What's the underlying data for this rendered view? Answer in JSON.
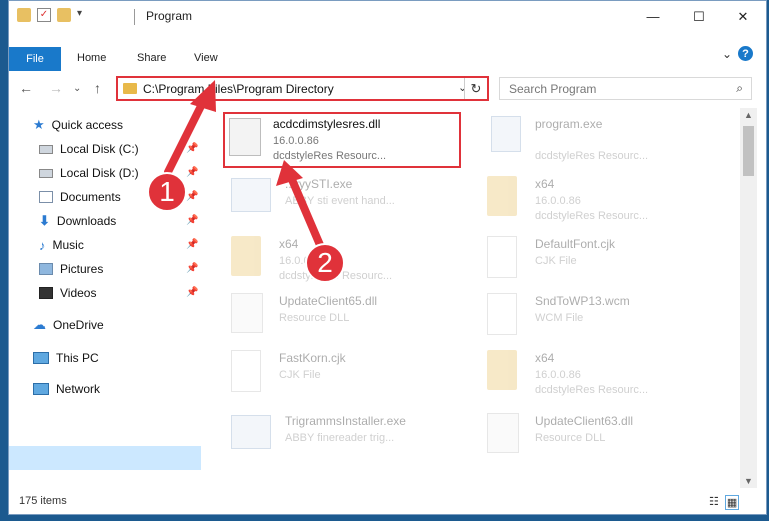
{
  "window": {
    "title": "Program",
    "controls": {
      "minimize": "—",
      "maximize": "☐",
      "close": "✕"
    }
  },
  "ribbon": {
    "file": "File",
    "tabs": [
      "Home",
      "Share",
      "View"
    ],
    "expand": "⌄",
    "help": "?"
  },
  "nav_buttons": {
    "back": "←",
    "forward": "→",
    "dropdown": "⌄",
    "up": "↑"
  },
  "address": {
    "path": "C:\\Program Files\\Program Directory",
    "dropdown": "⌄",
    "refresh": "↻"
  },
  "search": {
    "placeholder": "Search Program",
    "icon": "⌕"
  },
  "sidebar": {
    "items": [
      {
        "label": "Quick access",
        "icon": "star-icon",
        "pinned": false
      },
      {
        "label": "Local Disk (C:)",
        "icon": "drive-icon",
        "pinned": true
      },
      {
        "label": "Local Disk (D:)",
        "icon": "drive-icon",
        "pinned": true
      },
      {
        "label": "Documents",
        "icon": "documents-icon",
        "pinned": true
      },
      {
        "label": "Downloads",
        "icon": "downloads-icon",
        "pinned": true
      },
      {
        "label": "Music",
        "icon": "music-icon",
        "pinned": true
      },
      {
        "label": "Pictures",
        "icon": "pictures-icon",
        "pinned": true
      },
      {
        "label": "Videos",
        "icon": "videos-icon",
        "pinned": true
      },
      {
        "label": "OneDrive",
        "icon": "onedrive-icon",
        "pinned": false
      },
      {
        "label": "This PC",
        "icon": "computer-icon",
        "pinned": false,
        "selected": true
      },
      {
        "label": "Network",
        "icon": "network-icon",
        "pinned": false
      }
    ]
  },
  "files": [
    {
      "name": "acdcdimstylesres.dll",
      "l2": "16.0.0.86",
      "l3": "dcdstyleRes Resourc...",
      "kind": "dll",
      "highlighted": true
    },
    {
      "name": "program.exe",
      "l2": "dcdstyleRes Resourc...",
      "l3": "",
      "kind": "app"
    },
    {
      "name": "...ryySTI.exe",
      "l2": "ABBY sti event hand...",
      "l3": "",
      "kind": "app"
    },
    {
      "name": "x64",
      "l2": "16.0.0.86",
      "l3": "dcdstyleRes Resourc...",
      "kind": "folder"
    },
    {
      "name": "x64",
      "l2": "16.0.0.86",
      "l3": "dcdstyleRes Resourc...",
      "kind": "folder"
    },
    {
      "name": "DefaultFont.cjk",
      "l2": "CJK File",
      "l3": "",
      "kind": "doc"
    },
    {
      "name": "UpdateClient65.dll",
      "l2": "Resource DLL",
      "l3": "",
      "kind": "dll"
    },
    {
      "name": "SndToWP13.wcm",
      "l2": "WCM File",
      "l3": "",
      "kind": "doc"
    },
    {
      "name": "FastKorn.cjk",
      "l2": "CJK File",
      "l3": "",
      "kind": "doc"
    },
    {
      "name": "x64",
      "l2": "16.0.0.86",
      "l3": "dcdstyleRes Resourc...",
      "kind": "folder"
    },
    {
      "name": "TrigrammsInstaller.exe",
      "l2": "ABBY finereader trig...",
      "l3": "",
      "kind": "app"
    },
    {
      "name": "UpdateClient63.dll",
      "l2": "Resource DLL",
      "l3": "",
      "kind": "dll"
    }
  ],
  "status": {
    "count": "175 items"
  },
  "annotations": {
    "step1": "1",
    "step2": "2"
  },
  "colors": {
    "accent": "#1979ca",
    "highlight": "#e0323a",
    "selection": "#cce8ff"
  }
}
